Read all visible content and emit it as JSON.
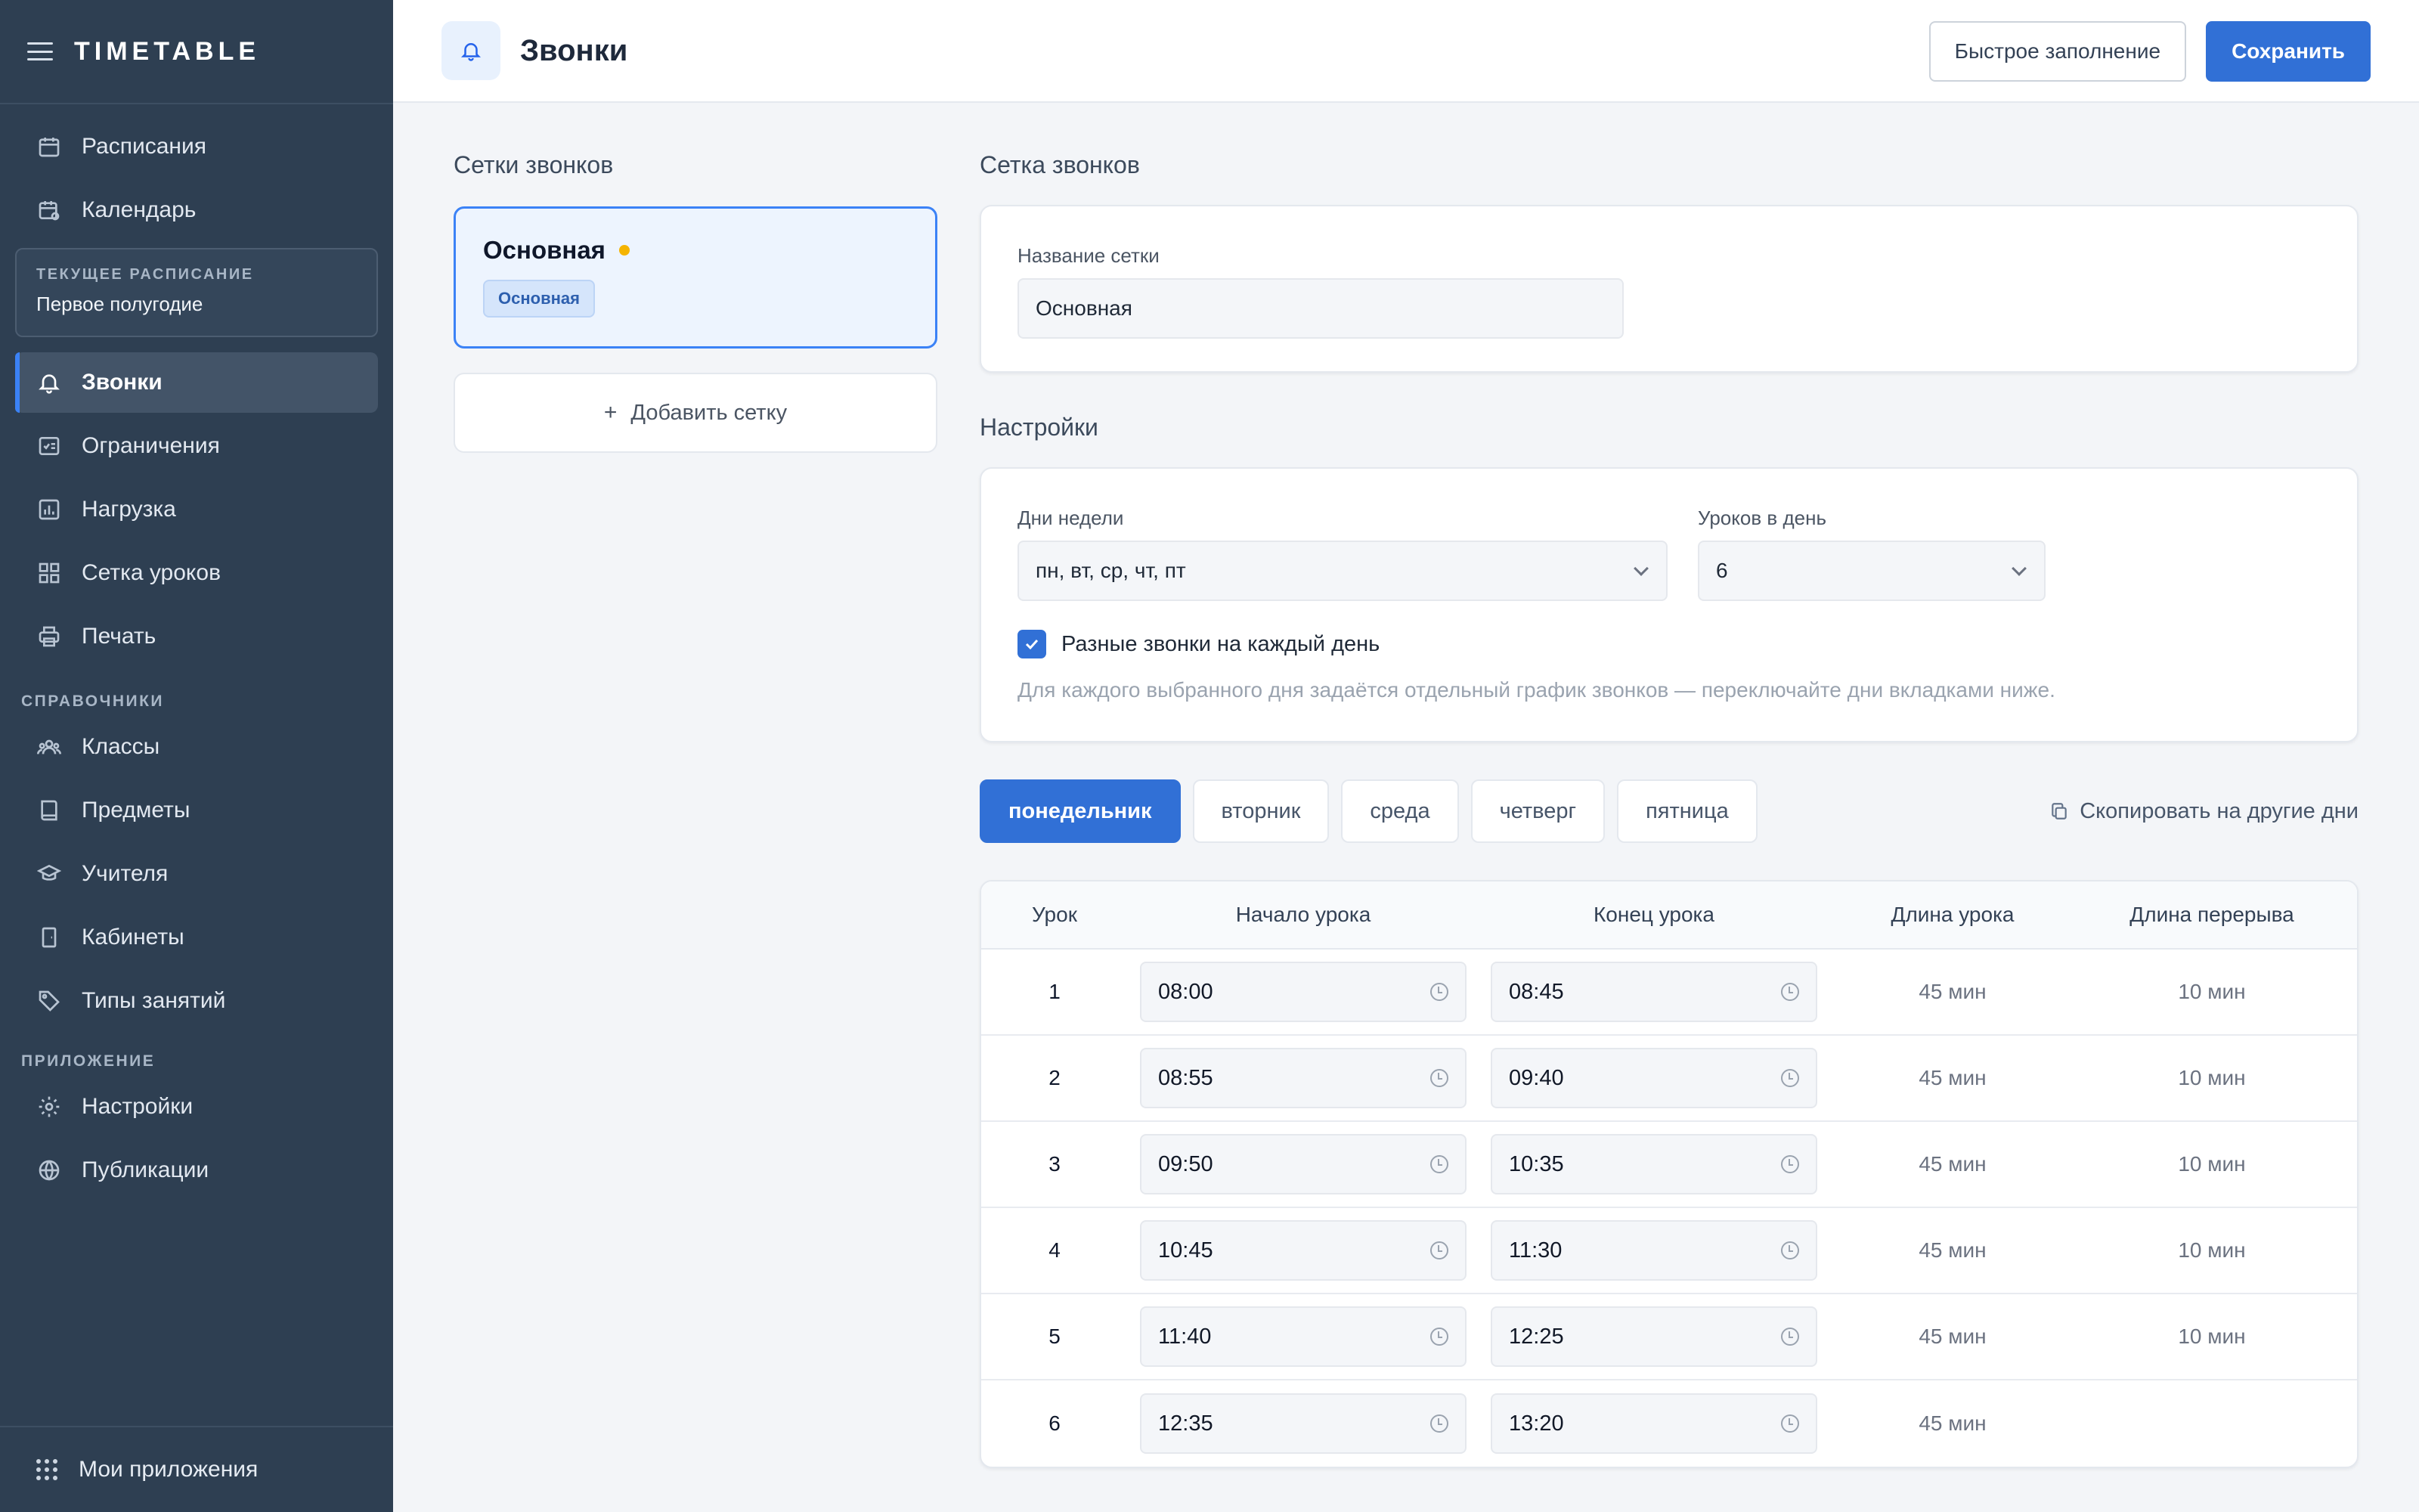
{
  "app": {
    "brand": "TIMETABLE"
  },
  "sidebar": {
    "top_items": [
      {
        "label": "Расписания",
        "icon": "calendar-icon"
      },
      {
        "label": "Календарь",
        "icon": "calendar-clock-icon"
      }
    ],
    "current": {
      "label": "ТЕКУЩЕЕ РАСПИСАНИЕ",
      "value": "Первое полугодие"
    },
    "main_items": [
      {
        "label": "Звонки",
        "icon": "bell-icon",
        "active": true
      },
      {
        "label": "Ограничения",
        "icon": "checklist-icon"
      },
      {
        "label": "Нагрузка",
        "icon": "bar-chart-icon"
      },
      {
        "label": "Сетка уроков",
        "icon": "grid-icon"
      },
      {
        "label": "Печать",
        "icon": "printer-icon"
      }
    ],
    "section_refs": "СПРАВОЧНИКИ",
    "ref_items": [
      {
        "label": "Классы",
        "icon": "users-icon"
      },
      {
        "label": "Предметы",
        "icon": "book-icon"
      },
      {
        "label": "Учителя",
        "icon": "graduation-cap-icon"
      },
      {
        "label": "Кабинеты",
        "icon": "door-icon"
      },
      {
        "label": "Типы занятий",
        "icon": "tag-icon"
      }
    ],
    "section_app": "ПРИЛОЖЕНИЕ",
    "app_items": [
      {
        "label": "Настройки",
        "icon": "gear-icon"
      },
      {
        "label": "Публикации",
        "icon": "globe-icon"
      }
    ],
    "footer": {
      "label": "Мои приложения",
      "icon": "apps-grid-icon"
    }
  },
  "header": {
    "title": "Звонки",
    "quick_fill": "Быстрое заполнение",
    "save": "Сохранить"
  },
  "grids": {
    "title": "Сетки звонков",
    "items": [
      {
        "name": "Основная",
        "badge": "Основная"
      }
    ],
    "add_label": "Добавить сетку"
  },
  "grid_form": {
    "title": "Сетка звонков",
    "name_label": "Название сетки",
    "name_value": "Основная"
  },
  "settings": {
    "title": "Настройки",
    "days_label": "Дни недели",
    "days_value": "пн, вт, ср, чт, пт",
    "lessons_label": "Уроков в день",
    "lessons_value": "6",
    "diff_checkbox": "Разные звонки на каждый день",
    "diff_checked": true,
    "hint": "Для каждого выбранного дня задаётся отдельный график звонков — переключайте дни вкладками ниже."
  },
  "day_tabs": [
    "понедельник",
    "вторник",
    "среда",
    "четверг",
    "пятница"
  ],
  "active_tab": "понедельник",
  "copy_label": "Скопировать на другие дни",
  "table": {
    "headers": [
      "Урок",
      "Начало урока",
      "Конец урока",
      "Длина урока",
      "Длина перерыва"
    ],
    "rows": [
      {
        "n": "1",
        "start": "08:00",
        "end": "08:45",
        "len": "45 мин",
        "brk": "10 мин"
      },
      {
        "n": "2",
        "start": "08:55",
        "end": "09:40",
        "len": "45 мин",
        "brk": "10 мин"
      },
      {
        "n": "3",
        "start": "09:50",
        "end": "10:35",
        "len": "45 мин",
        "brk": "10 мин"
      },
      {
        "n": "4",
        "start": "10:45",
        "end": "11:30",
        "len": "45 мин",
        "brk": "10 мин"
      },
      {
        "n": "5",
        "start": "11:40",
        "end": "12:25",
        "len": "45 мин",
        "brk": "10 мин"
      },
      {
        "n": "6",
        "start": "12:35",
        "end": "13:20",
        "len": "45 мин",
        "brk": ""
      }
    ]
  },
  "colors": {
    "accent": "#3170d6",
    "sidebar": "#2e3f52",
    "pending_dot": "#f5b400"
  }
}
